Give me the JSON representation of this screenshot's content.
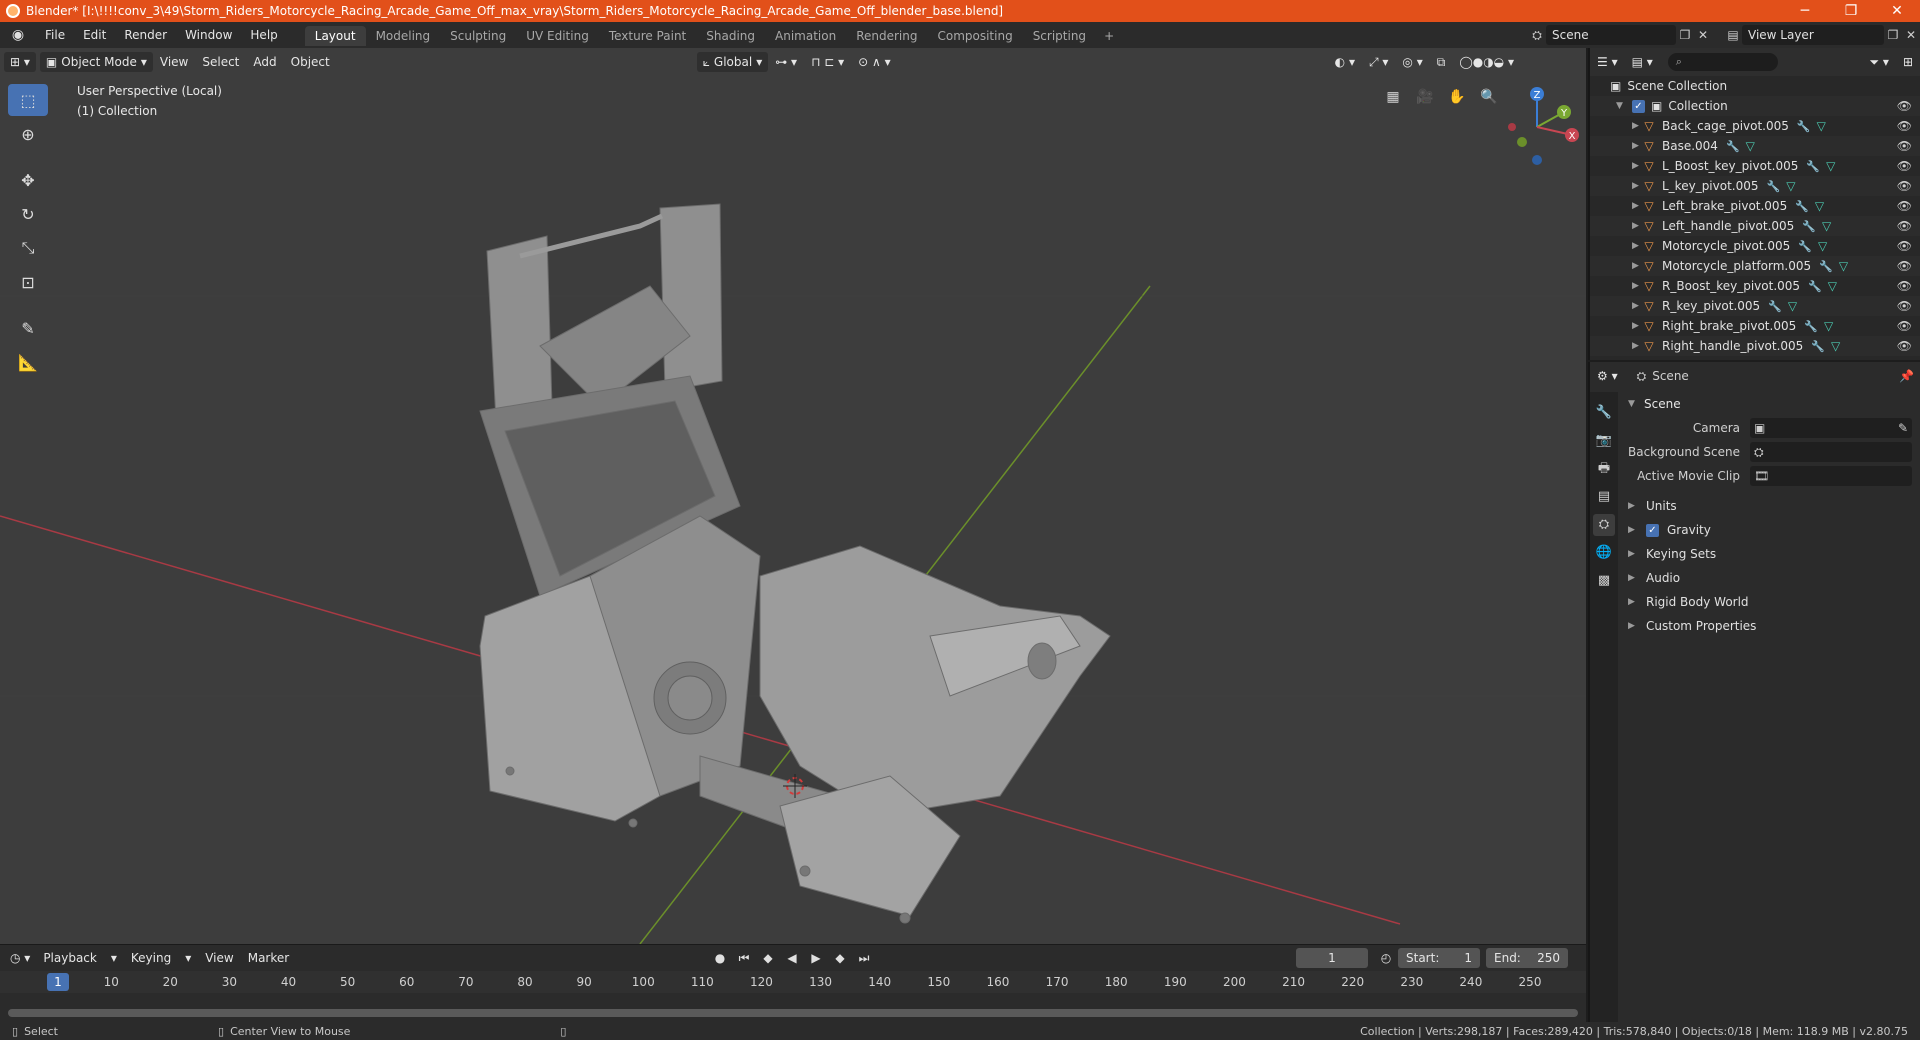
{
  "window": {
    "title": "Blender* [I:\\!!!!conv_3\\49\\Storm_Riders_Motorcycle_Racing_Arcade_Game_Off_max_vray\\Storm_Riders_Motorcycle_Racing_Arcade_Game_Off_blender_base.blend]",
    "minimize": "─",
    "maximize": "❐",
    "close": "✕"
  },
  "menu": {
    "items": [
      "File",
      "Edit",
      "Render",
      "Window",
      "Help"
    ],
    "workspaces": [
      "Layout",
      "Modeling",
      "Sculpting",
      "UV Editing",
      "Texture Paint",
      "Shading",
      "Animation",
      "Rendering",
      "Compositing",
      "Scripting"
    ],
    "active_workspace": "Layout",
    "add_tab": "+",
    "scene": "Scene",
    "view_layer": "View Layer"
  },
  "viewport": {
    "mode": "Object Mode",
    "menus": [
      "View",
      "Select",
      "Add",
      "Object"
    ],
    "transform": "Global",
    "info_line1": "User Perspective (Local)",
    "info_line2": "(1) Collection",
    "axes": {
      "x": "X",
      "y": "Y",
      "z": "Z"
    },
    "colors": {
      "x_axis": "#c84652",
      "y_axis": "#7aa832",
      "z_axis": "#3b7ed6",
      "bg": "#3d3d3d"
    }
  },
  "timeline": {
    "menus": [
      "Playback",
      "Keying",
      "View",
      "Marker"
    ],
    "current_frame": "1",
    "start_label": "Start:",
    "start": "1",
    "end_label": "End:",
    "end": "250",
    "ticks": [
      "1",
      "10",
      "20",
      "30",
      "40",
      "50",
      "60",
      "70",
      "80",
      "90",
      "100",
      "110",
      "120",
      "130",
      "140",
      "150",
      "160",
      "170",
      "180",
      "190",
      "200",
      "210",
      "220",
      "230",
      "240",
      "250"
    ]
  },
  "statusbar": {
    "left_action": "Select",
    "middle_action": "Center View to Mouse",
    "stats": "Collection | Verts:298,187 | Faces:289,420 | Tris:578,840 | Objects:0/18 | Mem: 118.9 MB | v2.80.75"
  },
  "outliner": {
    "root": "Scene Collection",
    "collection": "Collection",
    "objects": [
      "Back_cage_pivot.005",
      "Base.004",
      "L_Boost_key_pivot.005",
      "L_key_pivot.005",
      "Left_brake_pivot.005",
      "Left_handle_pivot.005",
      "Motorcycle_pivot.005",
      "Motorcycle_platform.005",
      "R_Boost_key_pivot.005",
      "R_key_pivot.005",
      "Right_brake_pivot.005",
      "Right_handle_pivot.005"
    ]
  },
  "properties": {
    "header": "Scene",
    "panel": "Scene",
    "camera_label": "Camera",
    "bg_scene_label": "Background Scene",
    "movie_clip_label": "Active Movie Clip",
    "subpanels": [
      "Units",
      "Gravity",
      "Keying Sets",
      "Audio",
      "Rigid Body World",
      "Custom Properties"
    ],
    "gravity_checked": true
  }
}
